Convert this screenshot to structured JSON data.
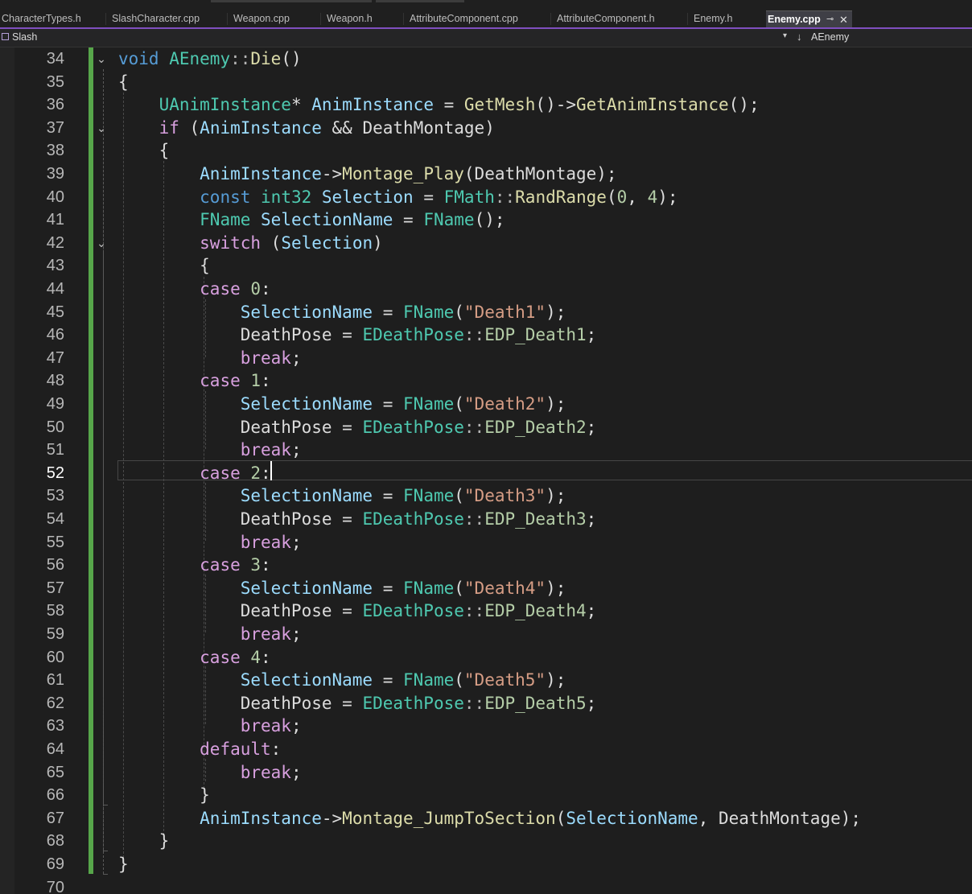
{
  "tabs": [
    {
      "label": "CharacterTypes.h",
      "active": false
    },
    {
      "label": "SlashCharacter.cpp",
      "active": false
    },
    {
      "label": "Weapon.cpp",
      "active": false
    },
    {
      "label": "Weapon.h",
      "active": false
    },
    {
      "label": "AttributeComponent.cpp",
      "active": false
    },
    {
      "label": "AttributeComponent.h",
      "active": false
    },
    {
      "label": "Enemy.h",
      "active": false
    },
    {
      "label": "Enemy.cpp",
      "active": true,
      "pin_icon": "pin-icon",
      "close_icon": "close-icon"
    }
  ],
  "navbar": {
    "project": "Slash",
    "project_icon": "project-icon",
    "member": "AEnemy",
    "member_icon": "member-arrow-icon",
    "dropdown_icon": "chevron-down-icon"
  },
  "editor": {
    "current_line": 52,
    "change_bar_color": "#57a64a",
    "syntax_colors": {
      "keyword": "#569cd6",
      "control": "#d8a0df",
      "type": "#4ec9b0",
      "function": "#dcdcaa",
      "variable": "#9cdcfe",
      "string": "#d69d85",
      "number": "#b5cea8",
      "plain": "#dcdcdc",
      "operator": "#b4b4b4"
    },
    "lines": [
      {
        "num": 34,
        "fold": true,
        "tokens": [
          [
            "void",
            "keyword"
          ],
          [
            " ",
            "plain"
          ],
          [
            "AEnemy",
            "type"
          ],
          [
            "::",
            "operator"
          ],
          [
            "Die",
            "function"
          ],
          [
            "()",
            "plain"
          ]
        ]
      },
      {
        "num": 35,
        "tokens": [
          [
            "{",
            "plain"
          ]
        ]
      },
      {
        "num": 36,
        "tokens": [
          [
            "    ",
            "plain"
          ],
          [
            "UAnimInstance",
            "type"
          ],
          [
            "* ",
            "plain"
          ],
          [
            "AnimInstance",
            "variable"
          ],
          [
            " = ",
            "plain"
          ],
          [
            "GetMesh",
            "function"
          ],
          [
            "()->",
            "plain"
          ],
          [
            "GetAnimInstance",
            "function"
          ],
          [
            "();",
            "plain"
          ]
        ]
      },
      {
        "num": 37,
        "fold": true,
        "tokens": [
          [
            "    ",
            "plain"
          ],
          [
            "if",
            "control"
          ],
          [
            " (",
            "plain"
          ],
          [
            "AnimInstance",
            "variable"
          ],
          [
            " && ",
            "plain"
          ],
          [
            "DeathMontage",
            "plain"
          ],
          [
            ")",
            "plain"
          ]
        ]
      },
      {
        "num": 38,
        "tokens": [
          [
            "    {",
            "plain"
          ]
        ]
      },
      {
        "num": 39,
        "tokens": [
          [
            "        ",
            "plain"
          ],
          [
            "AnimInstance",
            "variable"
          ],
          [
            "->",
            "plain"
          ],
          [
            "Montage_Play",
            "function"
          ],
          [
            "(",
            "plain"
          ],
          [
            "DeathMontage",
            "plain"
          ],
          [
            ");",
            "plain"
          ]
        ]
      },
      {
        "num": 40,
        "tokens": [
          [
            "        ",
            "plain"
          ],
          [
            "const",
            "keyword"
          ],
          [
            " ",
            "plain"
          ],
          [
            "int32",
            "type"
          ],
          [
            " ",
            "plain"
          ],
          [
            "Selection",
            "variable"
          ],
          [
            " = ",
            "plain"
          ],
          [
            "FMath",
            "type"
          ],
          [
            "::",
            "operator"
          ],
          [
            "RandRange",
            "function"
          ],
          [
            "(",
            "plain"
          ],
          [
            "0",
            "number"
          ],
          [
            ", ",
            "plain"
          ],
          [
            "4",
            "number"
          ],
          [
            ");",
            "plain"
          ]
        ]
      },
      {
        "num": 41,
        "tokens": [
          [
            "        ",
            "plain"
          ],
          [
            "FName",
            "type"
          ],
          [
            " ",
            "plain"
          ],
          [
            "SelectionName",
            "variable"
          ],
          [
            " = ",
            "plain"
          ],
          [
            "FName",
            "type"
          ],
          [
            "();",
            "plain"
          ]
        ]
      },
      {
        "num": 42,
        "fold": true,
        "tokens": [
          [
            "        ",
            "plain"
          ],
          [
            "switch",
            "control"
          ],
          [
            " (",
            "plain"
          ],
          [
            "Selection",
            "variable"
          ],
          [
            ")",
            "plain"
          ]
        ]
      },
      {
        "num": 43,
        "tokens": [
          [
            "        {",
            "plain"
          ]
        ]
      },
      {
        "num": 44,
        "tokens": [
          [
            "        ",
            "plain"
          ],
          [
            "case",
            "control"
          ],
          [
            " ",
            "plain"
          ],
          [
            "0",
            "number"
          ],
          [
            ":",
            "plain"
          ]
        ]
      },
      {
        "num": 45,
        "tokens": [
          [
            "            ",
            "plain"
          ],
          [
            "SelectionName",
            "variable"
          ],
          [
            " = ",
            "plain"
          ],
          [
            "FName",
            "type"
          ],
          [
            "(",
            "plain"
          ],
          [
            "\"Death1\"",
            "string"
          ],
          [
            ");",
            "plain"
          ]
        ]
      },
      {
        "num": 46,
        "tokens": [
          [
            "            ",
            "plain"
          ],
          [
            "DeathPose",
            "plain"
          ],
          [
            " = ",
            "plain"
          ],
          [
            "EDeathPose",
            "type"
          ],
          [
            "::",
            "operator"
          ],
          [
            "EDP_Death1",
            "number"
          ],
          [
            ";",
            "plain"
          ]
        ]
      },
      {
        "num": 47,
        "tokens": [
          [
            "            ",
            "plain"
          ],
          [
            "break",
            "control"
          ],
          [
            ";",
            "plain"
          ]
        ]
      },
      {
        "num": 48,
        "tokens": [
          [
            "        ",
            "plain"
          ],
          [
            "case",
            "control"
          ],
          [
            " ",
            "plain"
          ],
          [
            "1",
            "number"
          ],
          [
            ":",
            "plain"
          ]
        ]
      },
      {
        "num": 49,
        "tokens": [
          [
            "            ",
            "plain"
          ],
          [
            "SelectionName",
            "variable"
          ],
          [
            " = ",
            "plain"
          ],
          [
            "FName",
            "type"
          ],
          [
            "(",
            "plain"
          ],
          [
            "\"Death2\"",
            "string"
          ],
          [
            ");",
            "plain"
          ]
        ]
      },
      {
        "num": 50,
        "tokens": [
          [
            "            ",
            "plain"
          ],
          [
            "DeathPose",
            "plain"
          ],
          [
            " = ",
            "plain"
          ],
          [
            "EDeathPose",
            "type"
          ],
          [
            "::",
            "operator"
          ],
          [
            "EDP_Death2",
            "number"
          ],
          [
            ";",
            "plain"
          ]
        ]
      },
      {
        "num": 51,
        "tokens": [
          [
            "            ",
            "plain"
          ],
          [
            "break",
            "control"
          ],
          [
            ";",
            "plain"
          ]
        ]
      },
      {
        "num": 52,
        "tokens": [
          [
            "        ",
            "plain"
          ],
          [
            "case",
            "control"
          ],
          [
            " ",
            "plain"
          ],
          [
            "2",
            "number"
          ],
          [
            ":",
            "plain"
          ]
        ]
      },
      {
        "num": 53,
        "tokens": [
          [
            "            ",
            "plain"
          ],
          [
            "SelectionName",
            "variable"
          ],
          [
            " = ",
            "plain"
          ],
          [
            "FName",
            "type"
          ],
          [
            "(",
            "plain"
          ],
          [
            "\"Death3\"",
            "string"
          ],
          [
            ");",
            "plain"
          ]
        ]
      },
      {
        "num": 54,
        "tokens": [
          [
            "            ",
            "plain"
          ],
          [
            "DeathPose",
            "plain"
          ],
          [
            " = ",
            "plain"
          ],
          [
            "EDeathPose",
            "type"
          ],
          [
            "::",
            "operator"
          ],
          [
            "EDP_Death3",
            "number"
          ],
          [
            ";",
            "plain"
          ]
        ]
      },
      {
        "num": 55,
        "tokens": [
          [
            "            ",
            "plain"
          ],
          [
            "break",
            "control"
          ],
          [
            ";",
            "plain"
          ]
        ]
      },
      {
        "num": 56,
        "tokens": [
          [
            "        ",
            "plain"
          ],
          [
            "case",
            "control"
          ],
          [
            " ",
            "plain"
          ],
          [
            "3",
            "number"
          ],
          [
            ":",
            "plain"
          ]
        ]
      },
      {
        "num": 57,
        "tokens": [
          [
            "            ",
            "plain"
          ],
          [
            "SelectionName",
            "variable"
          ],
          [
            " = ",
            "plain"
          ],
          [
            "FName",
            "type"
          ],
          [
            "(",
            "plain"
          ],
          [
            "\"Death4\"",
            "string"
          ],
          [
            ");",
            "plain"
          ]
        ]
      },
      {
        "num": 58,
        "tokens": [
          [
            "            ",
            "plain"
          ],
          [
            "DeathPose",
            "plain"
          ],
          [
            " = ",
            "plain"
          ],
          [
            "EDeathPose",
            "type"
          ],
          [
            "::",
            "operator"
          ],
          [
            "EDP_Death4",
            "number"
          ],
          [
            ";",
            "plain"
          ]
        ]
      },
      {
        "num": 59,
        "tokens": [
          [
            "            ",
            "plain"
          ],
          [
            "break",
            "control"
          ],
          [
            ";",
            "plain"
          ]
        ]
      },
      {
        "num": 60,
        "tokens": [
          [
            "        ",
            "plain"
          ],
          [
            "case",
            "control"
          ],
          [
            " ",
            "plain"
          ],
          [
            "4",
            "number"
          ],
          [
            ":",
            "plain"
          ]
        ]
      },
      {
        "num": 61,
        "tokens": [
          [
            "            ",
            "plain"
          ],
          [
            "SelectionName",
            "variable"
          ],
          [
            " = ",
            "plain"
          ],
          [
            "FName",
            "type"
          ],
          [
            "(",
            "plain"
          ],
          [
            "\"Death5\"",
            "string"
          ],
          [
            ");",
            "plain"
          ]
        ]
      },
      {
        "num": 62,
        "tokens": [
          [
            "            ",
            "plain"
          ],
          [
            "DeathPose",
            "plain"
          ],
          [
            " = ",
            "plain"
          ],
          [
            "EDeathPose",
            "type"
          ],
          [
            "::",
            "operator"
          ],
          [
            "EDP_Death5",
            "number"
          ],
          [
            ";",
            "plain"
          ]
        ]
      },
      {
        "num": 63,
        "tokens": [
          [
            "            ",
            "plain"
          ],
          [
            "break",
            "control"
          ],
          [
            ";",
            "plain"
          ]
        ]
      },
      {
        "num": 64,
        "tokens": [
          [
            "        ",
            "plain"
          ],
          [
            "default",
            "control"
          ],
          [
            ":",
            "plain"
          ]
        ]
      },
      {
        "num": 65,
        "tokens": [
          [
            "            ",
            "plain"
          ],
          [
            "break",
            "control"
          ],
          [
            ";",
            "plain"
          ]
        ]
      },
      {
        "num": 66,
        "tokens": [
          [
            "        }",
            "plain"
          ]
        ]
      },
      {
        "num": 67,
        "tokens": [
          [
            "        ",
            "plain"
          ],
          [
            "AnimInstance",
            "variable"
          ],
          [
            "->",
            "plain"
          ],
          [
            "Montage_JumpToSection",
            "function"
          ],
          [
            "(",
            "plain"
          ],
          [
            "SelectionName",
            "variable"
          ],
          [
            ", ",
            "plain"
          ],
          [
            "DeathMontage",
            "plain"
          ],
          [
            ");",
            "plain"
          ]
        ]
      },
      {
        "num": 68,
        "tokens": [
          [
            "    }",
            "plain"
          ]
        ]
      },
      {
        "num": 69,
        "tokens": [
          [
            "}",
            "plain"
          ]
        ]
      },
      {
        "num": 70,
        "tokens": []
      }
    ]
  }
}
